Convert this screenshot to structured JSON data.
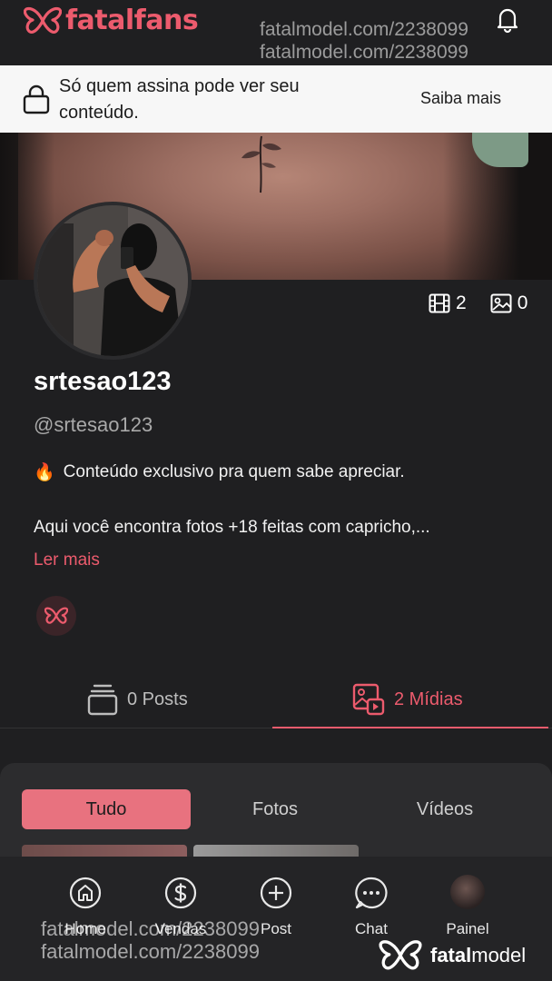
{
  "header": {
    "logo_text": "fatalfans",
    "watermark": "fatalmodel.com/2238099",
    "brand_color": "#ec5b6d"
  },
  "banner": {
    "message": "Só quem assina pode ver seu conteúdo.",
    "link": "Saiba mais"
  },
  "profile": {
    "video_count": "2",
    "image_count": "0",
    "name": "srtesao123",
    "handle": "@srtesao123",
    "bio_line1": "Conteúdo exclusivo pra quem sabe apreciar.",
    "bio_line2": "Aqui você encontra fotos +18 feitas com capricho,...",
    "read_more": "Ler mais",
    "bio_emoji": "🔥"
  },
  "tabs": [
    {
      "label": "0 Posts",
      "active": false
    },
    {
      "label": "2 Mídias",
      "active": true
    }
  ],
  "filters": [
    {
      "label": "Tudo",
      "active": true
    },
    {
      "label": "Fotos",
      "active": false
    },
    {
      "label": "Vídeos",
      "active": false
    }
  ],
  "nav": [
    {
      "label": "Home",
      "icon": "home-icon"
    },
    {
      "label": "Vendas",
      "icon": "dollar-icon"
    },
    {
      "label": "Post",
      "icon": "plus-circle-icon"
    },
    {
      "label": "Chat",
      "icon": "chat-icon"
    },
    {
      "label": "Painel",
      "icon": "avatar"
    }
  ],
  "footer": {
    "watermark": "fatalmodel.com/2238099",
    "brand_text_bold": "fatal",
    "brand_text": "model"
  }
}
